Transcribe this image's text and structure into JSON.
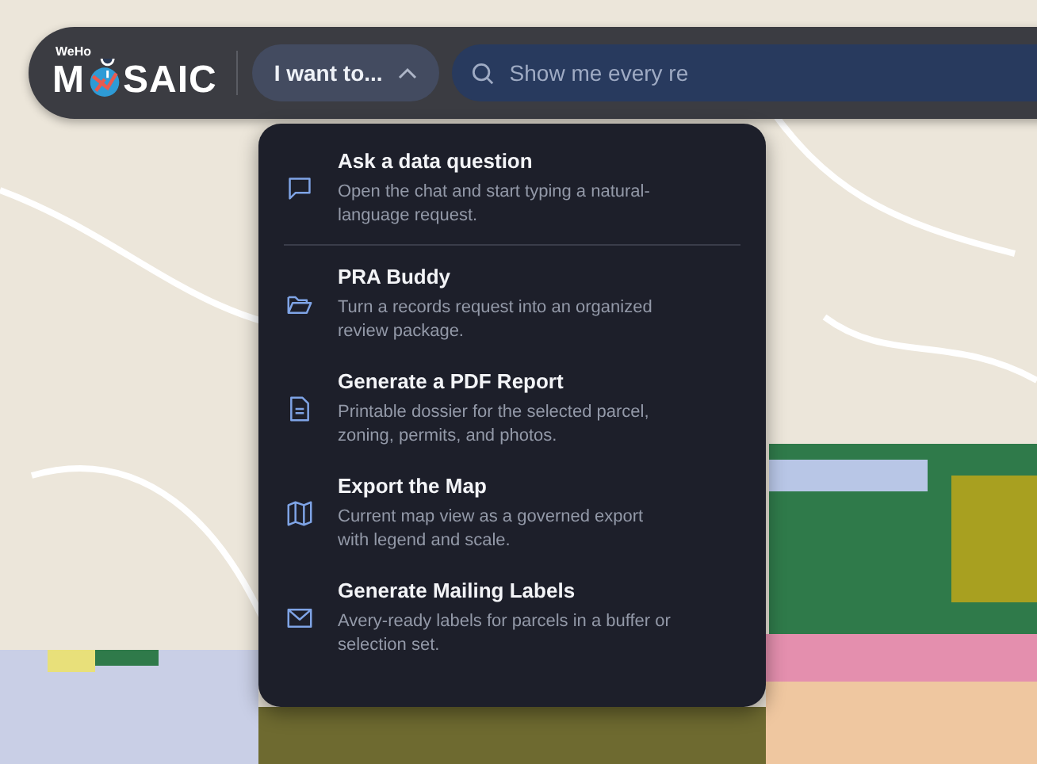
{
  "header": {
    "logo": {
      "small": "WeHo",
      "before": "M",
      "after": "SAIC"
    },
    "menu_button": {
      "label": "I want to...",
      "expanded": true
    },
    "search": {
      "placeholder": "Show me every re"
    }
  },
  "menu": {
    "groups": [
      [
        {
          "title": "Ask a data question",
          "description": "Open the chat and start typing a natural-language request."
        }
      ],
      [
        {
          "title": "PRA Buddy",
          "description": "Turn a records request into an organized review package."
        },
        {
          "title": "Generate a PDF Report",
          "description": "Printable dossier for the selected parcel, zoning, permits, and photos."
        },
        {
          "title": "Export the Map",
          "description": "Current map view as a governed export with legend and scale."
        },
        {
          "title": "Generate Mailing Labels",
          "description": "Avery-ready labels for parcels in a buffer or selection set."
        }
      ]
    ]
  }
}
